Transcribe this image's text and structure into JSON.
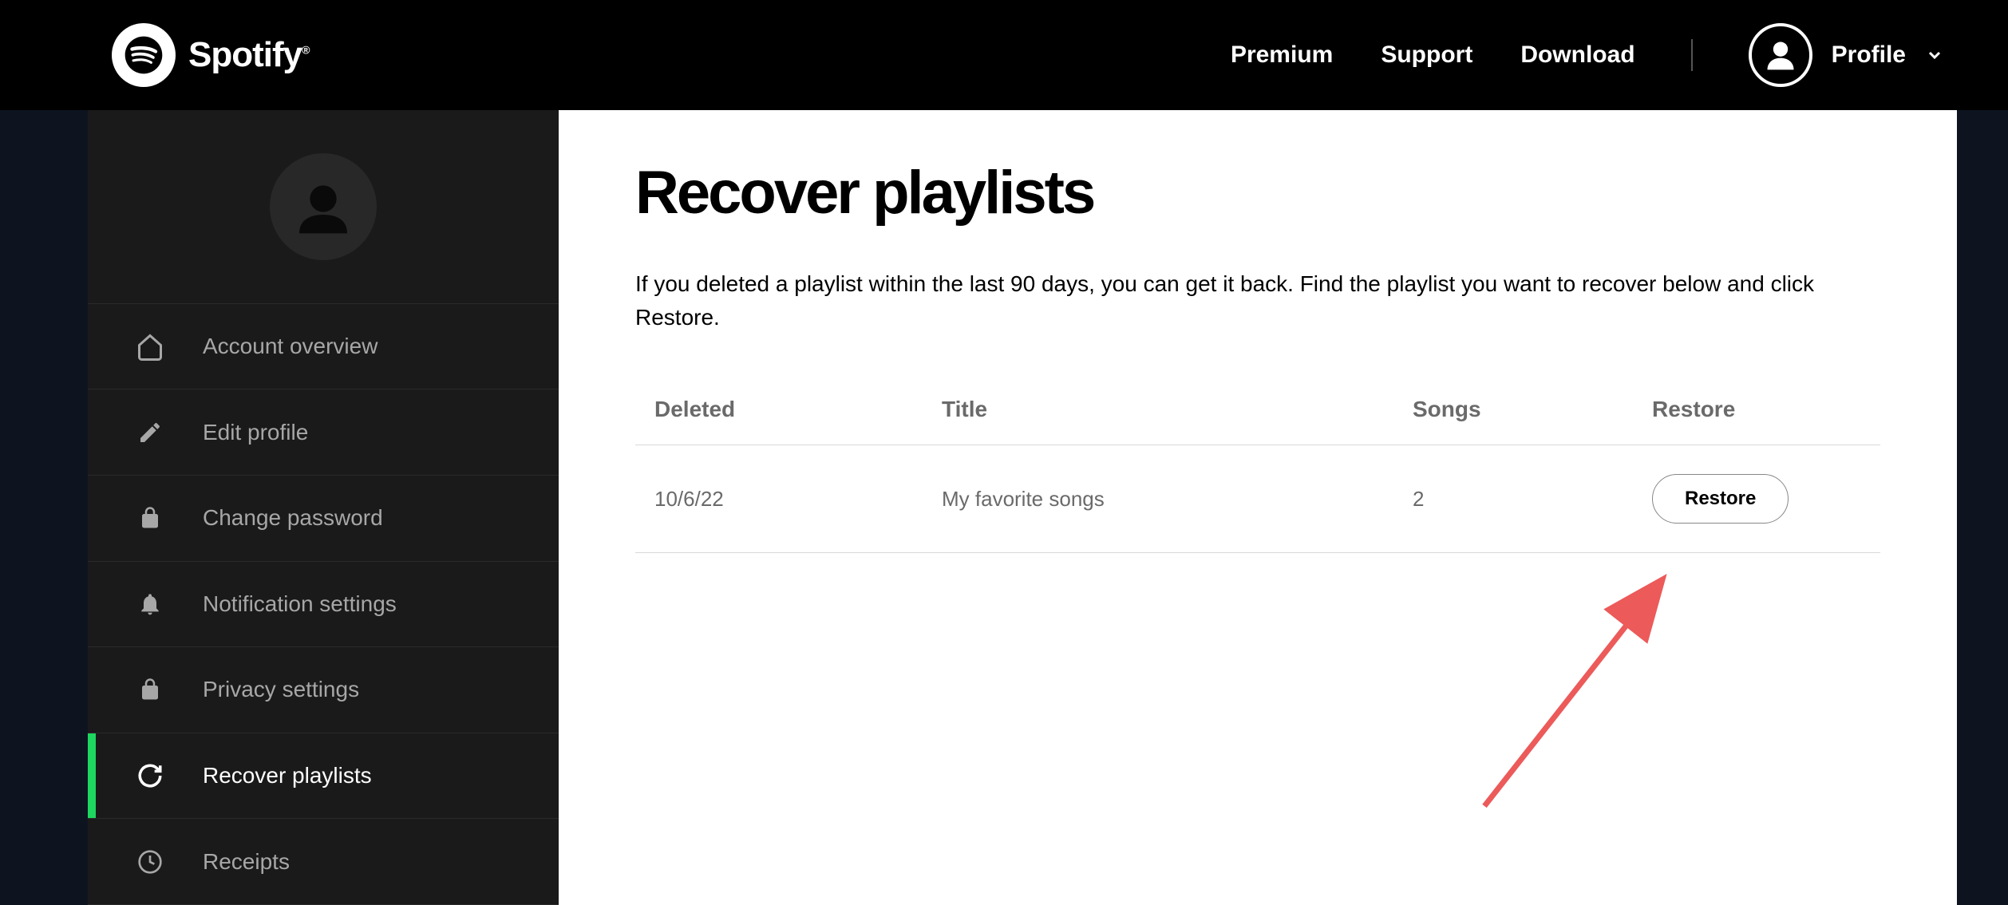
{
  "header": {
    "brand": "Spotify",
    "nav": {
      "premium": "Premium",
      "support": "Support",
      "download": "Download",
      "profile": "Profile"
    }
  },
  "sidebar": {
    "items": [
      {
        "label": "Account overview",
        "icon": "home-icon"
      },
      {
        "label": "Edit profile",
        "icon": "pencil-icon"
      },
      {
        "label": "Change password",
        "icon": "lock-icon"
      },
      {
        "label": "Notification settings",
        "icon": "bell-icon"
      },
      {
        "label": "Privacy settings",
        "icon": "lock-icon"
      },
      {
        "label": "Recover playlists",
        "icon": "refresh-icon"
      },
      {
        "label": "Receipts",
        "icon": "clock-icon"
      }
    ]
  },
  "main": {
    "title": "Recover playlists",
    "description": "If you deleted a playlist within the last 90 days, you can get it back. Find the playlist you want to recover below and click Restore.",
    "table": {
      "headers": {
        "deleted": "Deleted",
        "title": "Title",
        "songs": "Songs",
        "restore": "Restore"
      },
      "rows": [
        {
          "deleted": "10/6/22",
          "title": "My favorite songs",
          "songs": "2",
          "restore_label": "Restore"
        }
      ]
    }
  }
}
